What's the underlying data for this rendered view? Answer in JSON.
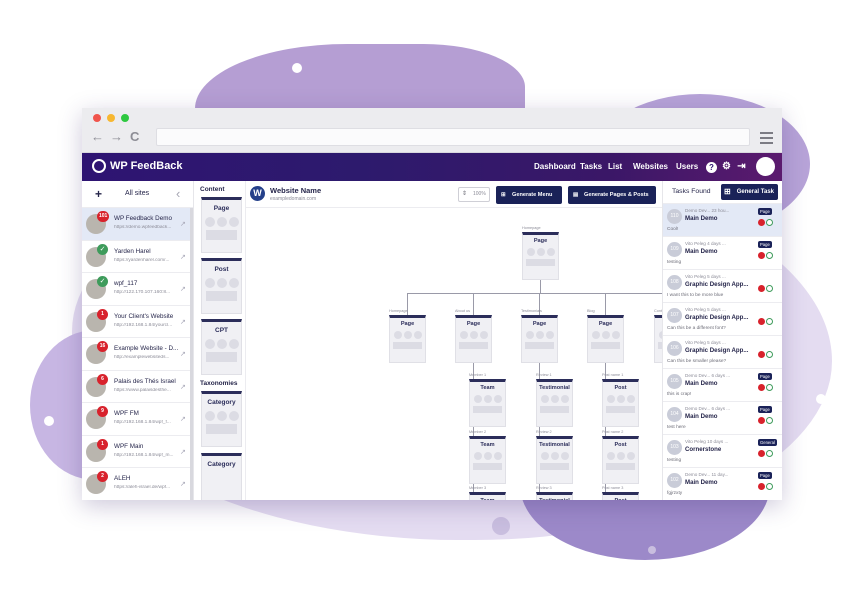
{
  "browser": {
    "back": "←",
    "forward": "→",
    "reload": "C"
  },
  "topbar": {
    "brand": "WP FeedBack",
    "nav": [
      "Dashboard",
      "Tasks",
      "List",
      "Websites",
      "Users"
    ],
    "help_icon": "?"
  },
  "sidebar": {
    "add": "+",
    "title": "All sites",
    "collapse": "‹",
    "sites": [
      {
        "name": "WP Feedback Demo",
        "url": "https://demo.wpfeedback...",
        "badge": "101",
        "selected": true
      },
      {
        "name": "Yarden Harel",
        "url": "https://yardenharel.com/...",
        "check": "✓"
      },
      {
        "name": "wpf_117",
        "url": "http://122.170.107.160:8...",
        "check": "✓"
      },
      {
        "name": "Your Client's Website",
        "url": "http://192.168.1.84/yourcl...",
        "badge": "1"
      },
      {
        "name": "Example Website - D...",
        "url": "http://examplewebsiteds...",
        "badge": "16"
      },
      {
        "name": "Palais des Thés Israel",
        "url": "https://www.palaisdesthe...",
        "badge": "6"
      },
      {
        "name": "WPF FM",
        "url": "http://192.168.1.84/wpf_f...",
        "badge": "9"
      },
      {
        "name": "WPF Main",
        "url": "http://192.168.1.84/wpf_m...",
        "badge": "1"
      },
      {
        "name": "ALEH",
        "url": "https://aleh-israel.de/wpf...",
        "badge": "2"
      }
    ]
  },
  "content": {
    "title": "Content",
    "cards": [
      "Page",
      "Post",
      "CPT"
    ],
    "taxonomies_title": "Taxonomies",
    "tax_cards": [
      "Category",
      "Category"
    ]
  },
  "header": {
    "wp_icon": "W",
    "site_name": "Website Name",
    "site_domain": "exampledomain.com",
    "zoom": "100%",
    "generate_menu": "Generate Menu",
    "generate_pages": "Generate Pages & Posts"
  },
  "sitemap": {
    "root": {
      "caption": "Homepage",
      "label": "Page"
    },
    "level1": [
      {
        "caption": "Homepage",
        "label": "Page"
      },
      {
        "caption": "About us",
        "label": "Page"
      },
      {
        "caption": "Testimonials",
        "label": "Page"
      },
      {
        "caption": "Blog",
        "label": "Page"
      },
      {
        "caption": "Contact",
        "label": "Page"
      }
    ],
    "team": [
      {
        "caption": "Member 1",
        "label": "Team"
      },
      {
        "caption": "Member 2",
        "label": "Team"
      },
      {
        "caption": "Member 3",
        "label": "Team"
      }
    ],
    "testimonials": [
      {
        "caption": "Review 1",
        "label": "Testimonial"
      },
      {
        "caption": "Review 2",
        "label": "Testimonial"
      },
      {
        "caption": "Review 3",
        "label": "Testimonial"
      }
    ],
    "posts": [
      {
        "caption": "Post name 1",
        "label": "Post"
      },
      {
        "caption": "Post name 2",
        "label": "Post"
      },
      {
        "caption": "Post name 3",
        "label": "Post"
      }
    ]
  },
  "tasks": {
    "title": "Tasks Found",
    "general_button": "General Task",
    "items": [
      {
        "num": "110",
        "meta": "Demo Dev... 23 hou...",
        "title": "Main Demo",
        "msg": "Cool!",
        "tag": "Page",
        "selected": true
      },
      {
        "num": "109",
        "meta": "Vito Peleg 4 days ...",
        "title": "Main Demo",
        "msg": "testing",
        "tag": "Page"
      },
      {
        "num": "108",
        "meta": "Vito Peleg 5 days ...",
        "title": "Graphic Design App...",
        "msg": "I want this to be more blue"
      },
      {
        "num": "107",
        "meta": "Vito Peleg 5 days ...",
        "title": "Graphic Design App...",
        "msg": "Can this be a different font?"
      },
      {
        "num": "106",
        "meta": "Vito Peleg 5 days ...",
        "title": "Graphic Design App...",
        "msg": "Can this be smaller please?"
      },
      {
        "num": "105",
        "meta": "Demo Dev... 6 days ...",
        "title": "Main Demo",
        "msg": "this is crap!",
        "tag": "Page"
      },
      {
        "num": "104",
        "meta": "Demo Dev... 6 days ...",
        "title": "Main Demo",
        "msg": "test here",
        "tag": "Page"
      },
      {
        "num": "103",
        "meta": "Vito Peleg 10 days ...",
        "title": "Cornerstone",
        "msg": "testing",
        "tag": "General"
      },
      {
        "num": "102",
        "meta": "Demo Dev... 11 day...",
        "title": "Main Demo",
        "msg": "fgjrzxty",
        "tag": "Page"
      }
    ]
  },
  "colors": {
    "brand_dark": "#1a2258",
    "header_gradient_start": "#2e1472",
    "header_gradient_end": "#5b1a6e",
    "badge_red": "#d8222c",
    "check_green": "#3e9b5b"
  }
}
